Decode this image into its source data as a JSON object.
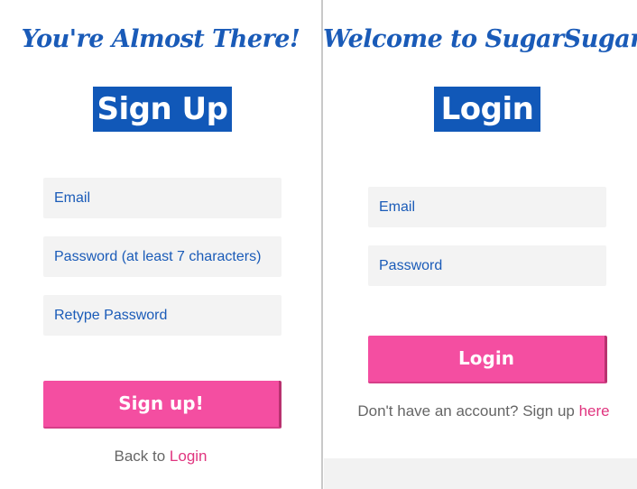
{
  "signup": {
    "heading": "You're Almost There!",
    "badge": "Sign Up",
    "email_placeholder": "Email",
    "password_placeholder": "Password (at least 7 characters)",
    "retype_placeholder": "Retype Password",
    "submit_label": "Sign up!",
    "back_prefix": "Back to ",
    "back_link": "Login"
  },
  "login": {
    "heading": "Welcome to SugarSugar",
    "badge": "Login",
    "email_placeholder": "Email",
    "password_placeholder": "Password",
    "submit_label": "Login",
    "signup_prefix": "Don't have an account? Sign up ",
    "signup_link": "here"
  },
  "colors": {
    "brand_blue": "#1158b8",
    "brand_pink": "#f44ea1",
    "link_pink": "#e0357f",
    "field_bg": "#f3f3f3"
  }
}
